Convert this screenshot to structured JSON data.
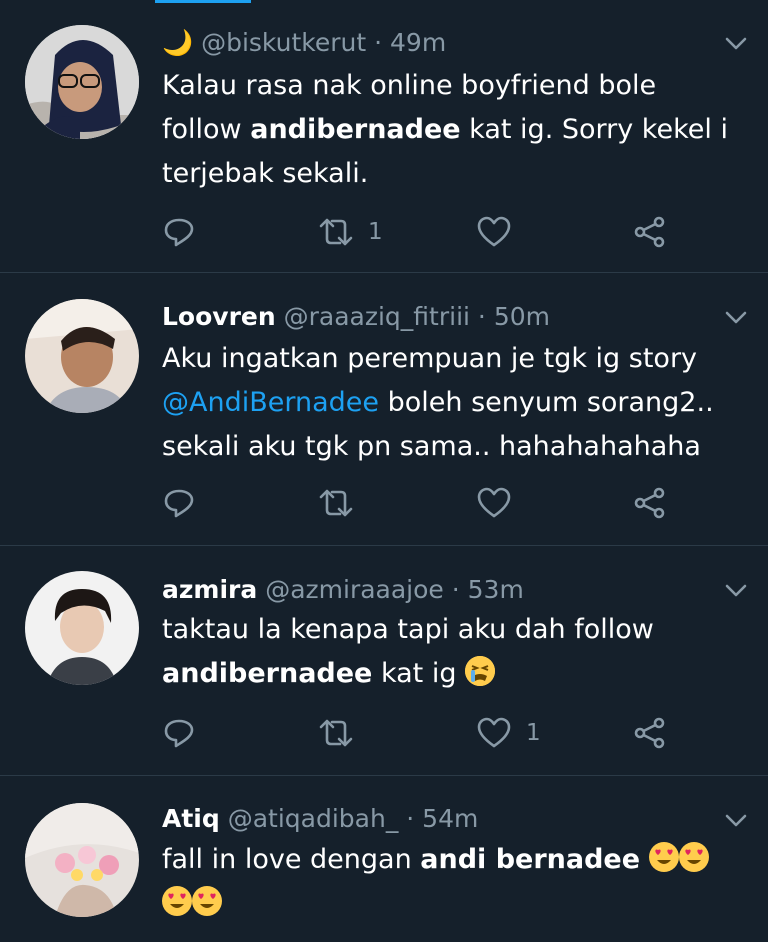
{
  "tweets": [
    {
      "display_name": "🌙",
      "handle": "@biskutkerut",
      "sep": " · ",
      "time": "49m",
      "lines": [
        "Kalau rasa nak online boyfriend bole",
        "follow ",
        "andibernadee",
        " kat ig. Sorry kekel i",
        "terjebak sekali."
      ],
      "retweets": "1",
      "likes": ""
    },
    {
      "display_name": "Loovren",
      "handle": "@raaaziq_fitriii",
      "sep": " · ",
      "time": "50m",
      "lines": [
        "Aku ingatkan perempuan je tgk ig story",
        "@AndiBernadee",
        " boleh senyum sorang2..",
        "sekali aku tgk pn sama.. hahahahahaha"
      ],
      "retweets": "",
      "likes": ""
    },
    {
      "display_name": "azmira",
      "handle": "@azmiraaajoe",
      "sep": " · ",
      "time": "53m",
      "lines": [
        "taktau la kenapa tapi aku dah follow",
        "andibernadee",
        " kat ig"
      ],
      "retweets": "",
      "likes": "1"
    },
    {
      "display_name": "Atiq",
      "handle": "@atiqadibah_",
      "sep": " · ",
      "time": "54m",
      "lines": [
        "fall in love dengan ",
        "andi bernadee"
      ],
      "retweets": "",
      "likes": ""
    }
  ],
  "colors": {
    "background": "#15202b",
    "accent": "#1da1f2",
    "muted": "#8899a6",
    "divider": "#2b3a47"
  },
  "icons": [
    "reply-icon",
    "retweet-icon",
    "like-icon",
    "share-icon",
    "chevron-down-icon"
  ]
}
